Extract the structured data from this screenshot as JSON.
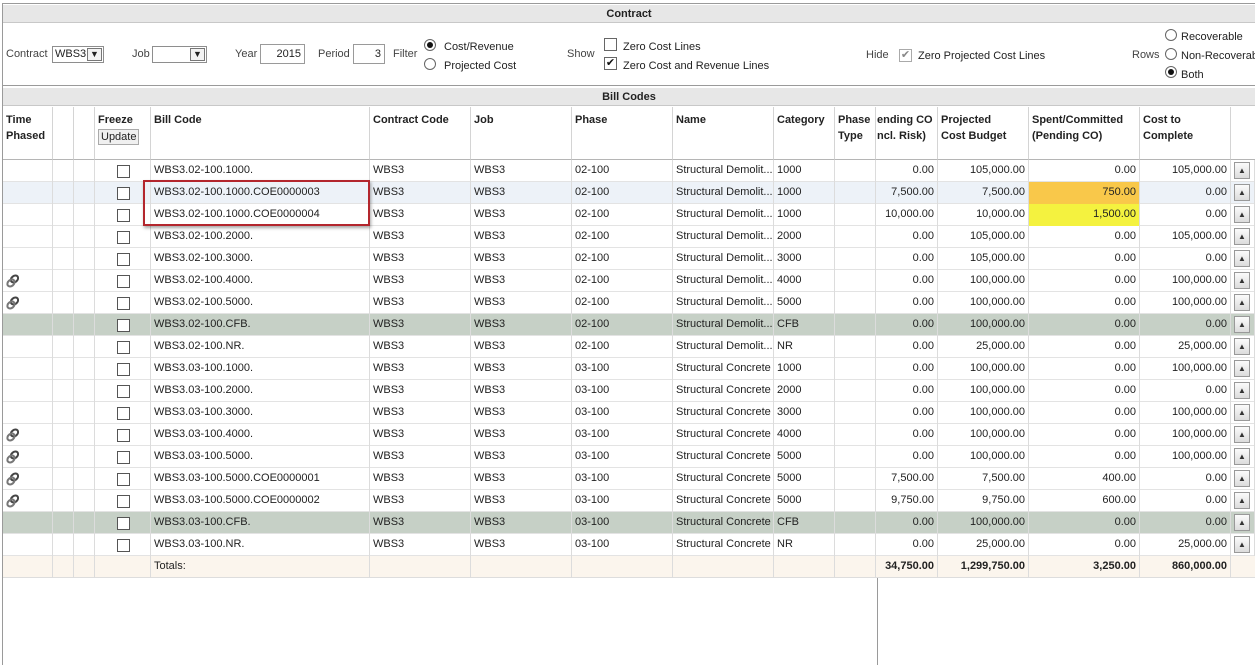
{
  "sections": {
    "contract": "Contract",
    "bill_codes": "Bill Codes"
  },
  "filters": {
    "contract_label": "Contract",
    "contract_value": "WBS3",
    "job_label": "Job",
    "job_value": "",
    "year_label": "Year",
    "year_value": "2015",
    "period_label": "Period",
    "period_value": "3",
    "filter_label": "Filter",
    "filter_opt1": "Cost/Revenue",
    "filter_opt2": "Projected Cost",
    "show_label": "Show",
    "show_opt1": "Zero Cost Lines",
    "show_opt2": "Zero Cost and Revenue Lines",
    "hide_label": "Hide",
    "hide_opt1": "Zero Projected Cost Lines",
    "rows_label": "Rows",
    "rows_opt1": "Recoverable",
    "rows_opt2": "Non-Recoverable",
    "rows_opt3": "Both"
  },
  "headers": {
    "time_phased_1": "Time",
    "time_phased_2": "Phased",
    "freeze": "Freeze",
    "update": "Update",
    "bill_code": "Bill Code",
    "contract_code": "Contract Code",
    "job": "Job",
    "phase": "Phase",
    "name": "Name",
    "category": "Category",
    "phase_type_1": "Phase",
    "phase_type_2": "Type",
    "pending_co_1": "ending CO",
    "pending_co_2": "ncl. Risk)",
    "projected_1": "Projected",
    "projected_2": "Cost Budget",
    "spent_1": "Spent/Committed",
    "spent_2": "(Pending CO)",
    "ctc_1": "Cost to",
    "ctc_2": "Complete"
  },
  "rows": [
    {
      "bill": "WBS3.02-100.1000.",
      "contract": "WBS3",
      "job": "WBS3",
      "phase": "02-100",
      "name": "Structural Demolit...",
      "cat": "1000",
      "pend": "0.00",
      "proj": "105,000.00",
      "spent": "0.00",
      "ctc": "105,000.00"
    },
    {
      "bill": "WBS3.02-100.1000.COE0000003",
      "contract": "WBS3",
      "job": "WBS3",
      "phase": "02-100",
      "name": "Structural Demolit...",
      "cat": "1000",
      "pend": "7,500.00",
      "proj": "7,500.00",
      "spent": "750.00",
      "ctc": "0.00"
    },
    {
      "bill": "WBS3.02-100.1000.COE0000004",
      "contract": "WBS3",
      "job": "WBS3",
      "phase": "02-100",
      "name": "Structural Demolit...",
      "cat": "1000",
      "pend": "10,000.00",
      "proj": "10,000.00",
      "spent": "1,500.00",
      "ctc": "0.00"
    },
    {
      "bill": "WBS3.02-100.2000.",
      "contract": "WBS3",
      "job": "WBS3",
      "phase": "02-100",
      "name": "Structural Demolit...",
      "cat": "2000",
      "pend": "0.00",
      "proj": "105,000.00",
      "spent": "0.00",
      "ctc": "105,000.00"
    },
    {
      "bill": "WBS3.02-100.3000.",
      "contract": "WBS3",
      "job": "WBS3",
      "phase": "02-100",
      "name": "Structural Demolit...",
      "cat": "3000",
      "pend": "0.00",
      "proj": "105,000.00",
      "spent": "0.00",
      "ctc": "0.00"
    },
    {
      "bill": "WBS3.02-100.4000.",
      "contract": "WBS3",
      "job": "WBS3",
      "phase": "02-100",
      "name": "Structural Demolit...",
      "cat": "4000",
      "pend": "0.00",
      "proj": "100,000.00",
      "spent": "0.00",
      "ctc": "100,000.00"
    },
    {
      "bill": "WBS3.02-100.5000.",
      "contract": "WBS3",
      "job": "WBS3",
      "phase": "02-100",
      "name": "Structural Demolit...",
      "cat": "5000",
      "pend": "0.00",
      "proj": "100,000.00",
      "spent": "0.00",
      "ctc": "100,000.00"
    },
    {
      "bill": "WBS3.02-100.CFB.",
      "contract": "WBS3",
      "job": "WBS3",
      "phase": "02-100",
      "name": "Structural Demolit...",
      "cat": "CFB",
      "pend": "0.00",
      "proj": "100,000.00",
      "spent": "0.00",
      "ctc": "0.00"
    },
    {
      "bill": "WBS3.02-100.NR.",
      "contract": "WBS3",
      "job": "WBS3",
      "phase": "02-100",
      "name": "Structural Demolit...",
      "cat": "NR",
      "pend": "0.00",
      "proj": "25,000.00",
      "spent": "0.00",
      "ctc": "25,000.00"
    },
    {
      "bill": "WBS3.03-100.1000.",
      "contract": "WBS3",
      "job": "WBS3",
      "phase": "03-100",
      "name": "Structural Concrete",
      "cat": "1000",
      "pend": "0.00",
      "proj": "100,000.00",
      "spent": "0.00",
      "ctc": "100,000.00"
    },
    {
      "bill": "WBS3.03-100.2000.",
      "contract": "WBS3",
      "job": "WBS3",
      "phase": "03-100",
      "name": "Structural Concrete",
      "cat": "2000",
      "pend": "0.00",
      "proj": "100,000.00",
      "spent": "0.00",
      "ctc": "0.00"
    },
    {
      "bill": "WBS3.03-100.3000.",
      "contract": "WBS3",
      "job": "WBS3",
      "phase": "03-100",
      "name": "Structural Concrete",
      "cat": "3000",
      "pend": "0.00",
      "proj": "100,000.00",
      "spent": "0.00",
      "ctc": "100,000.00"
    },
    {
      "bill": "WBS3.03-100.4000.",
      "contract": "WBS3",
      "job": "WBS3",
      "phase": "03-100",
      "name": "Structural Concrete",
      "cat": "4000",
      "pend": "0.00",
      "proj": "100,000.00",
      "spent": "0.00",
      "ctc": "100,000.00"
    },
    {
      "bill": "WBS3.03-100.5000.",
      "contract": "WBS3",
      "job": "WBS3",
      "phase": "03-100",
      "name": "Structural Concrete",
      "cat": "5000",
      "pend": "0.00",
      "proj": "100,000.00",
      "spent": "0.00",
      "ctc": "100,000.00"
    },
    {
      "bill": "WBS3.03-100.5000.COE0000001",
      "contract": "WBS3",
      "job": "WBS3",
      "phase": "03-100",
      "name": "Structural Concrete",
      "cat": "5000",
      "pend": "7,500.00",
      "proj": "7,500.00",
      "spent": "400.00",
      "ctc": "0.00"
    },
    {
      "bill": "WBS3.03-100.5000.COE0000002",
      "contract": "WBS3",
      "job": "WBS3",
      "phase": "03-100",
      "name": "Structural Concrete",
      "cat": "5000",
      "pend": "9,750.00",
      "proj": "9,750.00",
      "spent": "600.00",
      "ctc": "0.00"
    },
    {
      "bill": "WBS3.03-100.CFB.",
      "contract": "WBS3",
      "job": "WBS3",
      "phase": "03-100",
      "name": "Structural Concrete",
      "cat": "CFB",
      "pend": "0.00",
      "proj": "100,000.00",
      "spent": "0.00",
      "ctc": "0.00"
    },
    {
      "bill": "WBS3.03-100.NR.",
      "contract": "WBS3",
      "job": "WBS3",
      "phase": "03-100",
      "name": "Structural Concrete",
      "cat": "NR",
      "pend": "0.00",
      "proj": "25,000.00",
      "spent": "0.00",
      "ctc": "25,000.00"
    }
  ],
  "row_flags": {
    "linked": [
      5,
      6,
      12,
      13,
      14,
      15
    ],
    "group": [
      7,
      16
    ],
    "selected": [
      1
    ],
    "spent_highlight": {
      "1": "orange",
      "2": "yellow"
    }
  },
  "totals": {
    "label": "Totals:",
    "pend": "34,750.00",
    "proj": "1,299,750.00",
    "spent": "3,250.00",
    "ctc": "860,000.00"
  },
  "icons": {
    "link": "link-chain-icon",
    "scroll_up": "scroll-up-arrow-icon",
    "dropdown": "chevron-down-icon"
  }
}
